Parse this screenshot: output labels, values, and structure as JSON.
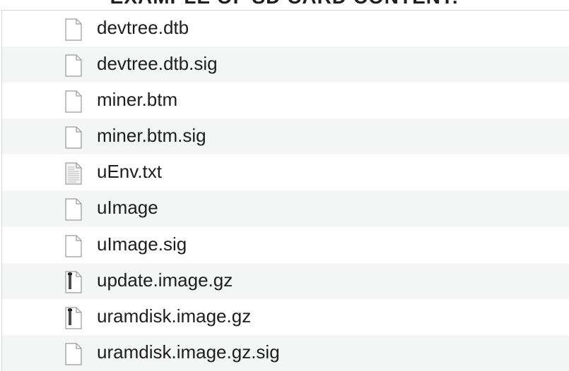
{
  "heading": "EXAMPLE OF SD CARD CONTENT:",
  "files": [
    {
      "name": "devtree.dtb",
      "icon": "blank-document-icon"
    },
    {
      "name": "devtree.dtb.sig",
      "icon": "blank-document-icon"
    },
    {
      "name": "miner.btm",
      "icon": "blank-document-icon"
    },
    {
      "name": "miner.btm.sig",
      "icon": "blank-document-icon"
    },
    {
      "name": "uEnv.txt",
      "icon": "text-document-icon"
    },
    {
      "name": "uImage",
      "icon": "blank-document-icon"
    },
    {
      "name": "uImage.sig",
      "icon": "blank-document-icon"
    },
    {
      "name": "update.image.gz",
      "icon": "archive-document-icon"
    },
    {
      "name": "uramdisk.image.gz",
      "icon": "archive-document-icon"
    },
    {
      "name": "uramdisk.image.gz.sig",
      "icon": "blank-document-icon"
    }
  ],
  "colors": {
    "row_alt": "#f4f5f5",
    "text": "#1e1e1e",
    "icon_stroke": "#9a9a9a"
  }
}
